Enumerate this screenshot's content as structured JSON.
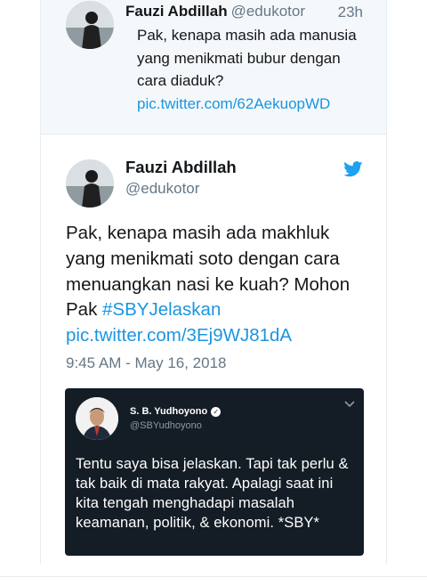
{
  "reply_tweet": {
    "author_name": "Fauzi Abdillah",
    "author_handle": "@edukotor",
    "time_ago": "23h",
    "text": "Pak, kenapa masih ada manusia yang menikmati bubur dengan cara diaduk?",
    "link": "pic.twitter.com/62AekuopWD"
  },
  "main_tweet": {
    "author_name": "Fauzi Abdillah",
    "author_handle": "@edukotor",
    "text": "Pak, kenapa masih ada makhluk yang menikmati soto dengan cara menuangkan nasi ke kuah? Mohon Pak",
    "hashtag": "#SBYJelaskan",
    "link": "pic.twitter.com/3Ej9WJ81dA",
    "timestamp": "9:45 AM - May 16, 2018",
    "icon": "twitter-bird-icon",
    "accent_color": "#1b95e0"
  },
  "embedded_card": {
    "author_name": "S. B. Yudhoyono",
    "author_handle": "@SBYudhoyono",
    "text": "Tentu saya bisa jelaskan. Tapi tak perlu & tak baik di mata rakyat. Apalagi saat ini kita tengah menghadapi masalah keamanan, politik, & ekonomi. *SBY*",
    "background_color": "#141d26"
  }
}
